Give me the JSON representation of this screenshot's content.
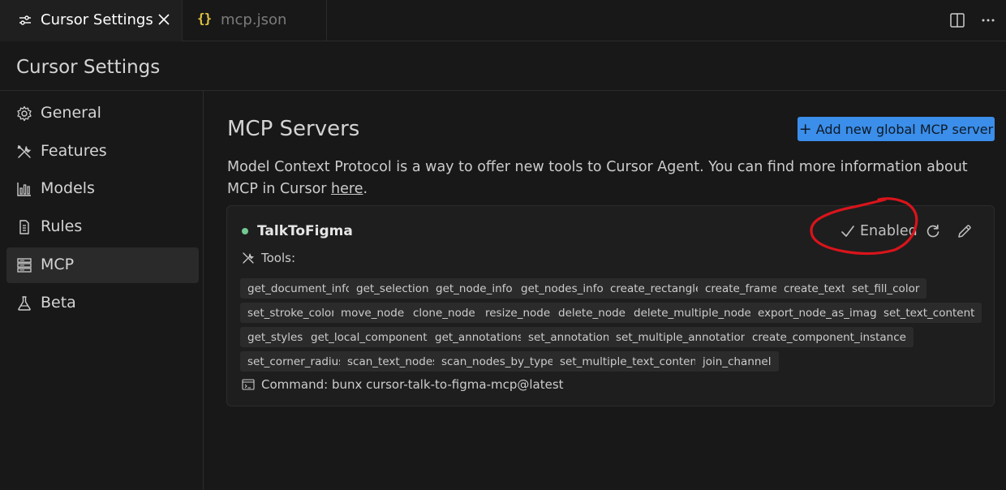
{
  "tabs": [
    {
      "label": "Cursor Settings",
      "icon": "settings-sliders-icon",
      "active": true
    },
    {
      "label": "mcp.json",
      "icon": "json-braces-icon",
      "icon_text": "{}",
      "active": false
    }
  ],
  "editor_actions": {
    "split_icon": "split-editor-icon",
    "more_icon": "more-actions-icon"
  },
  "page": {
    "title": "Cursor Settings"
  },
  "sidebar": {
    "items": [
      {
        "label": "General",
        "icon": "gear-icon"
      },
      {
        "label": "Features",
        "icon": "tools-icon"
      },
      {
        "label": "Models",
        "icon": "bar-chart-icon"
      },
      {
        "label": "Rules",
        "icon": "document-icon"
      },
      {
        "label": "MCP",
        "icon": "server-icon",
        "selected": true
      },
      {
        "label": "Beta",
        "icon": "flask-icon"
      }
    ]
  },
  "main": {
    "title": "MCP Servers",
    "add_button": {
      "plus": "+",
      "label": "Add new global MCP server"
    },
    "description": {
      "text": "Model Context Protocol is a way to offer new tools to Cursor Agent. You can find more information about MCP in Cursor ",
      "link": "here",
      "suffix": "."
    }
  },
  "server": {
    "name": "TalkToFigma",
    "status_color": "#73c991",
    "enabled_label": "Enabled",
    "tools_label": "Tools:",
    "tools": [
      "get_document_info",
      "get_selection",
      "get_node_info",
      "get_nodes_info",
      "create_rectangle",
      "create_frame",
      "create_text",
      "set_fill_color",
      "set_stroke_color",
      "move_node",
      "clone_node",
      "resize_node",
      "delete_node",
      "delete_multiple_nodes",
      "export_node_as_image",
      "set_text_content",
      "get_styles",
      "get_local_components",
      "get_annotations",
      "set_annotation",
      "set_multiple_annotations",
      "create_component_instance",
      "set_corner_radius",
      "scan_text_nodes",
      "scan_nodes_by_types",
      "set_multiple_text_contents",
      "join_channel"
    ],
    "command_label": "Command:",
    "command": "bunx cursor-talk-to-figma-mcp@latest"
  },
  "colors": {
    "accent": "#3b8eea",
    "annotation": "#d9141b",
    "json_icon": "#e2c541"
  }
}
